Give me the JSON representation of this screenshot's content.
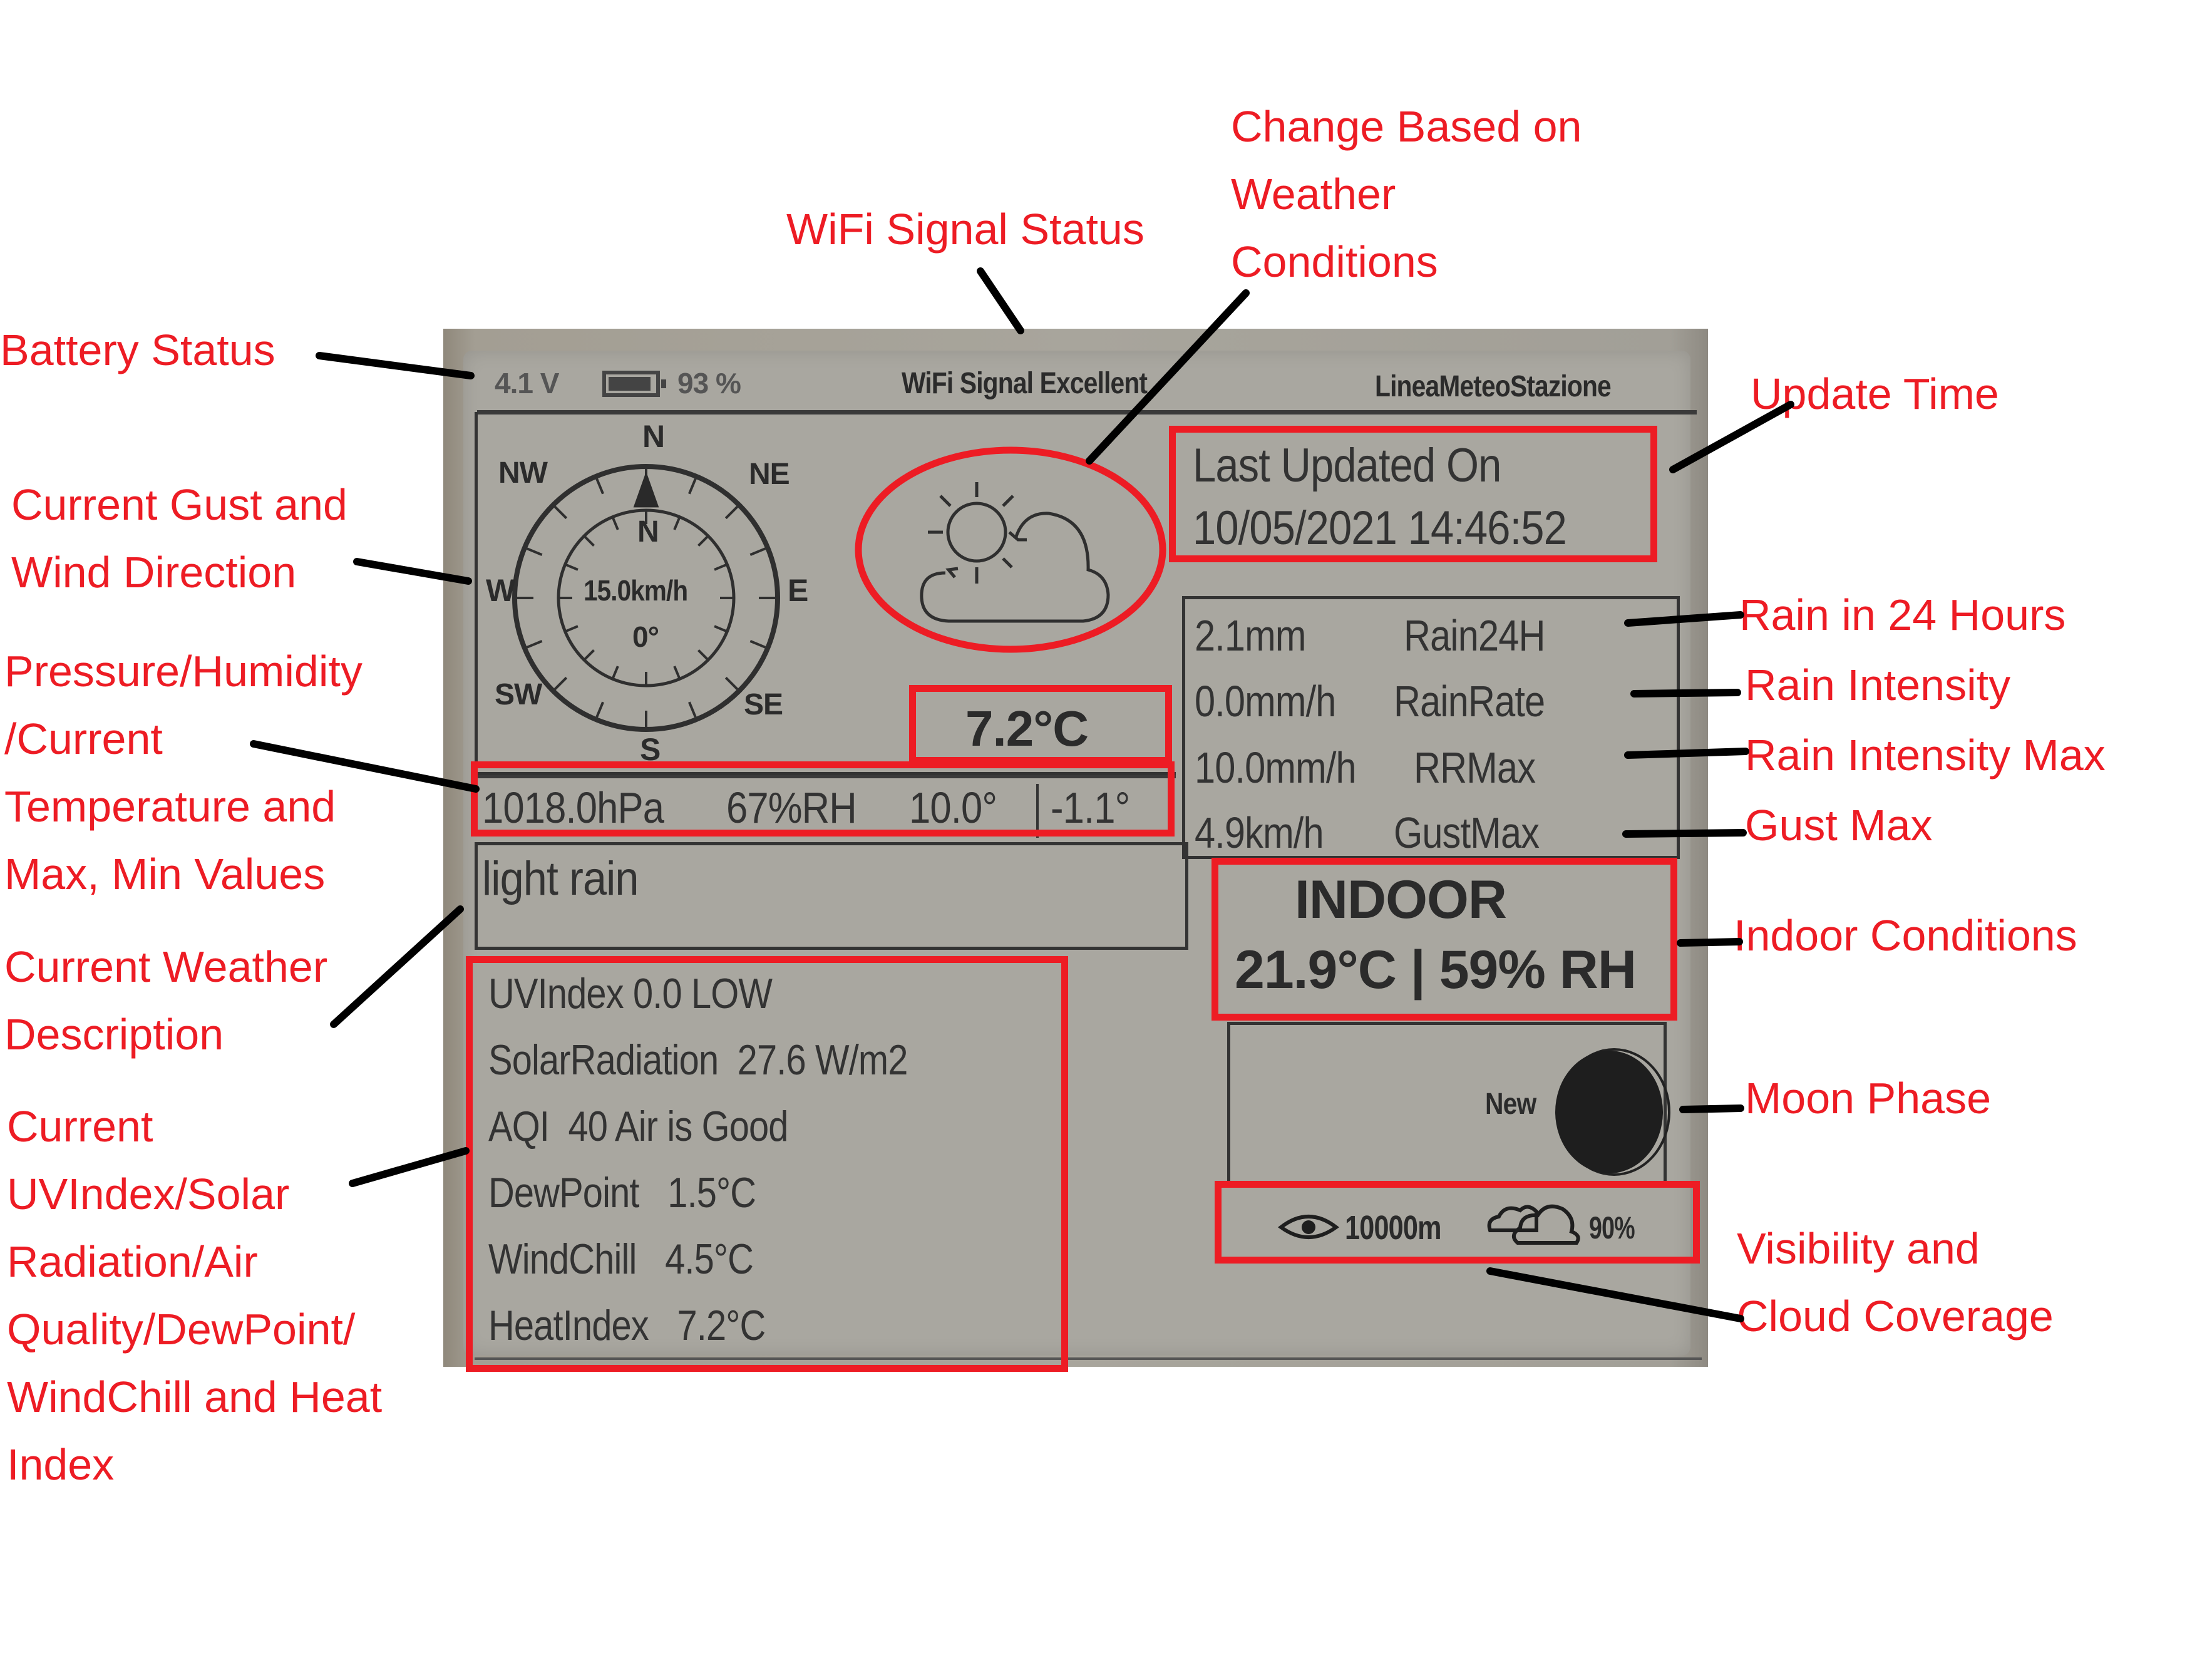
{
  "status_bar": {
    "battery_voltage": "4.1 V",
    "battery_icon": "battery-icon",
    "battery_percent": "93 %",
    "battery_level": 0.93,
    "wifi_status": "WiFi Signal Excellent",
    "station_name": "LineaMeteoStazione"
  },
  "compass": {
    "directions": {
      "n": "N",
      "ne": "NE",
      "e": "E",
      "se": "SE",
      "s": "S",
      "sw": "SW",
      "w": "W",
      "nw": "NW"
    },
    "direction_label": "N",
    "speed": "15.0km/h",
    "degrees": "0°",
    "wind_direction_deg": 0
  },
  "weather_icon": "partly-cloudy-icon",
  "current_temp": "7.2°C",
  "last_updated": {
    "label": "Last Updated On",
    "datetime": "10/05/2021 14:46:52"
  },
  "summary_row": {
    "pressure": "1018.0hPa",
    "humidity": "67%RH",
    "max_temp": "10.0°",
    "separator": "|",
    "min_temp": "-1.1°"
  },
  "description": "light rain",
  "rain": [
    {
      "value": "2.1mm",
      "label": "Rain24H"
    },
    {
      "value": "0.0mm/h",
      "label": "RainRate"
    },
    {
      "value": "10.0mm/h",
      "label": "RRMax"
    },
    {
      "value": "4.9km/h",
      "label": "GustMax"
    }
  ],
  "indoor": {
    "title": "INDOOR",
    "values": "21.9°C | 59% RH"
  },
  "moon": {
    "label": "New",
    "icon": "moon-icon"
  },
  "visibility": {
    "icon": "eye-icon",
    "value": "10000m",
    "cloud_icon": "clouds-icon",
    "cloud_coverage": "90%"
  },
  "details": [
    {
      "label": "UVIndex",
      "value": "0.0 LOW"
    },
    {
      "label": "SolarRadiation",
      "value": "27.6 W/m2"
    },
    {
      "label": "AQI",
      "value": "40  Air is Good"
    },
    {
      "label": "DewPoint",
      "value": "1.5°C"
    },
    {
      "label": "WindChill",
      "value": "4.5°C"
    },
    {
      "label": "HeatIndex",
      "value": "7.2°C"
    }
  ],
  "annotations": {
    "battery": "Battery Status",
    "wifi": "WiFi Signal Status",
    "weather_change": [
      "Change Based on",
      "Weather",
      "Conditions"
    ],
    "update_time": "Update Time",
    "gust_wind": [
      "Current Gust and",
      "Wind Direction"
    ],
    "pressure": [
      "Pressure/Humidity",
      "/Current",
      "Temperature and",
      "Max, Min Values"
    ],
    "description": [
      "Current Weather",
      "Description"
    ],
    "uv": [
      "Current",
      "UVIndex/Solar",
      "Radiation/Air",
      "Quality/DewPoint/",
      "WindChill and Heat",
      "Index"
    ],
    "rain24": "Rain in 24 Hours",
    "rain_intensity": "Rain Intensity",
    "rain_intensity_max": "Rain Intensity Max",
    "gust_max": "Gust Max",
    "indoor": "Indoor Conditions",
    "moon": "Moon Phase",
    "visibility": [
      "Visibility and",
      "Cloud Coverage"
    ]
  },
  "colors": {
    "annotation_red": "#ed1c24",
    "screen_bg": "#a9a7a0",
    "ink": "#2b2b2b"
  }
}
